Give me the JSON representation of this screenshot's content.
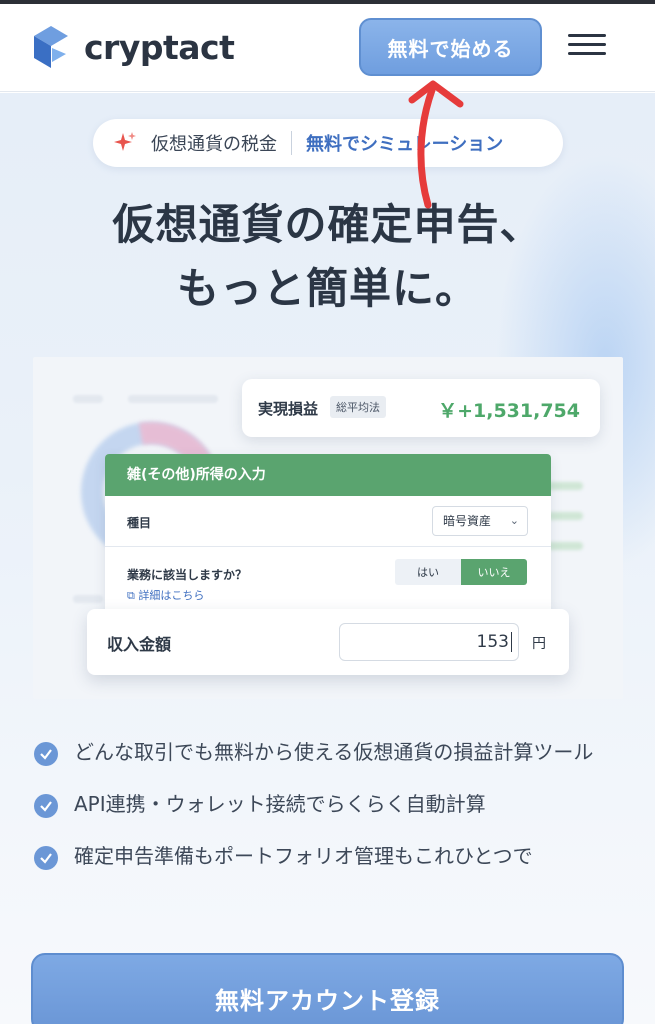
{
  "header": {
    "logo_text": "cryptact",
    "start_button": "無料で始める"
  },
  "hero": {
    "pill_left": "仮想通貨の税金",
    "pill_right": "無料でシミュレーション",
    "headline_line1": "仮想通貨の確定申告、",
    "headline_line2": "もっと簡単に。"
  },
  "preview": {
    "realized_label": "実現損益",
    "realized_badge": "総平均法",
    "realized_value": "￥+1,531,754",
    "form_title": "雑(その他)所得の入力",
    "field_type_label": "種目",
    "field_type_value": "暗号資産",
    "business_question": "業務に該当しますか？",
    "option_yes": "はい",
    "option_no": "いいえ",
    "detail_link": "詳細はこちら",
    "income_label": "収入金額",
    "income_value": "153",
    "income_unit": "円"
  },
  "features": [
    "どんな取引でも無料から使える仮想通貨の損益計算ツール",
    "API連携・ウォレット接続でらくらく自動計算",
    "確定申告準備もポートフォリオ管理もこれひとつで"
  ],
  "cta": {
    "signup_button": "無料アカウント登録"
  },
  "colors": {
    "accent_blue": "#6f9edf",
    "green": "#5aa46f",
    "profit_green": "#4ea86a",
    "annotation_red": "#e63b3b"
  }
}
